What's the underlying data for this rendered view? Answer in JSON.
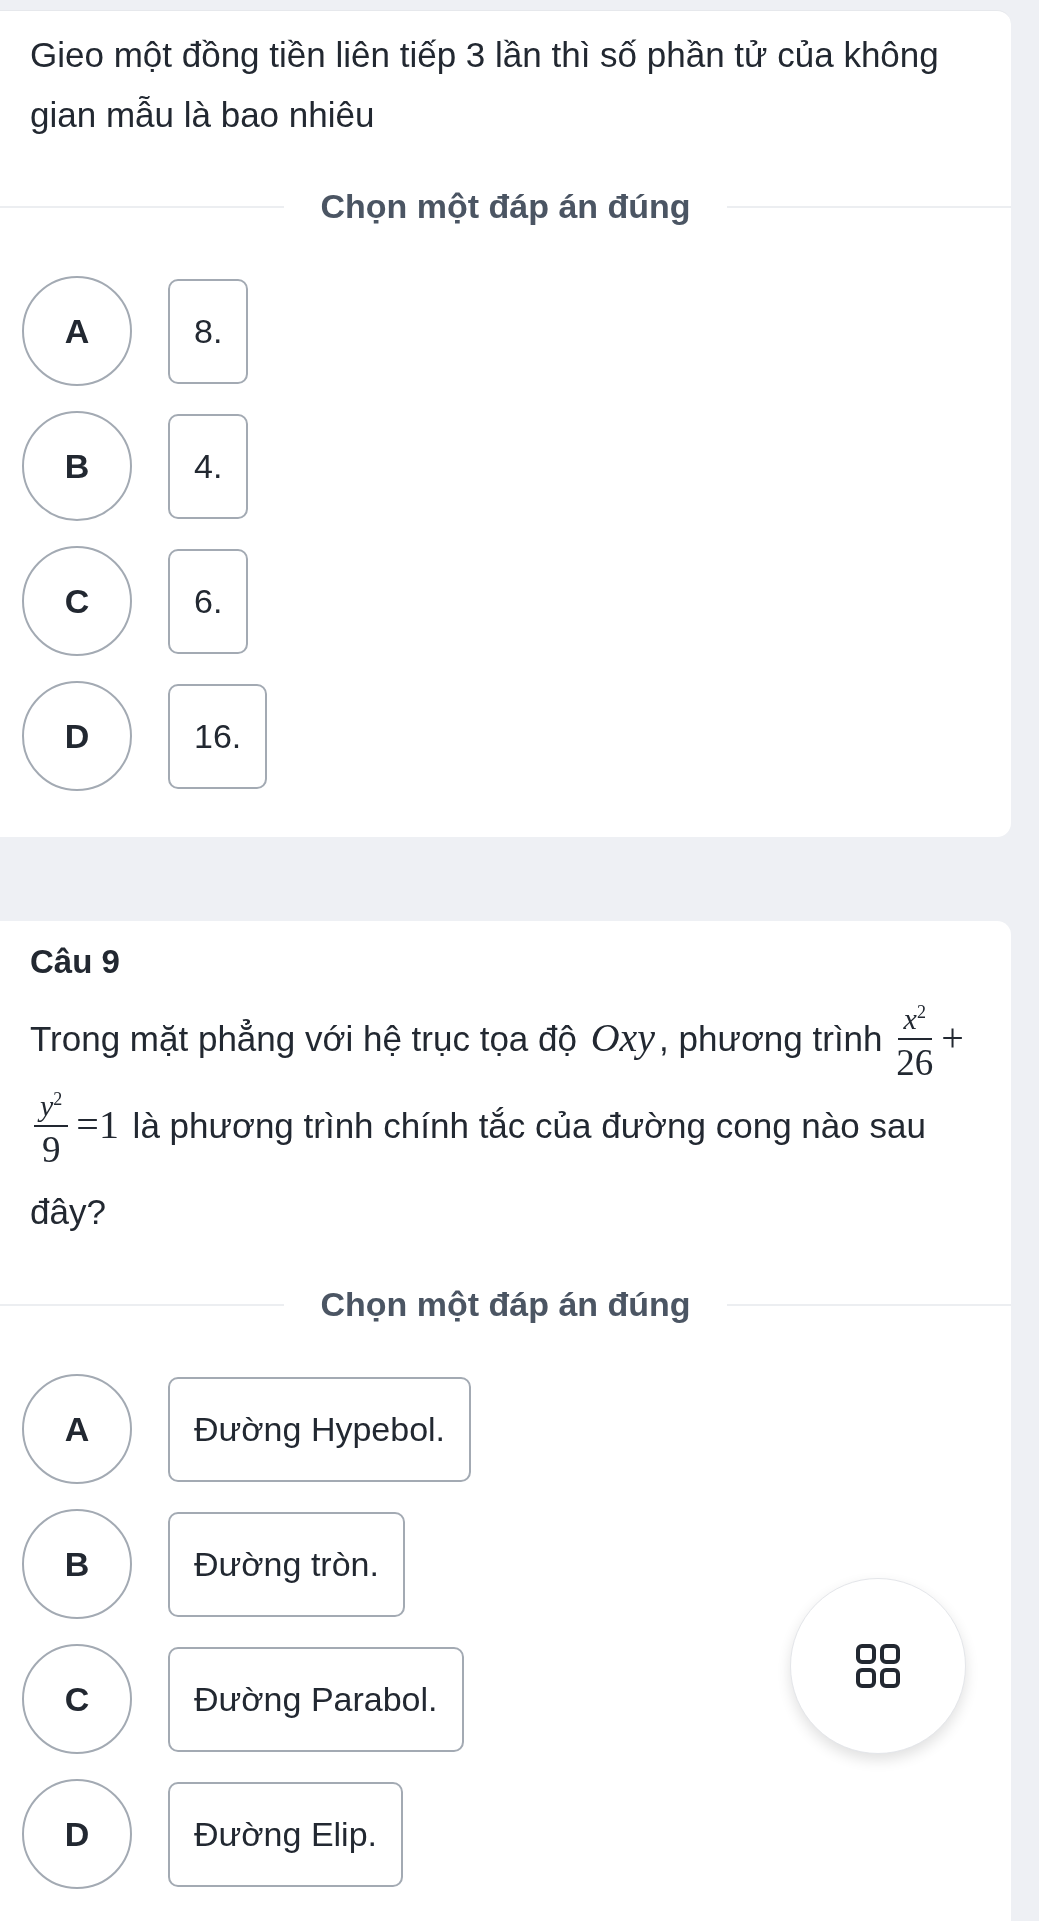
{
  "questions": [
    {
      "segments": [
        {
          "kind": "text",
          "text": "Gieo một đồng tiền liên tiếp 3 lần thì số phần tử của không gian mẫu là bao nhiêu"
        }
      ],
      "prompt": "Chọn một đáp án đúng",
      "options": [
        {
          "letter": "A",
          "text": "8."
        },
        {
          "letter": "B",
          "text": "4."
        },
        {
          "letter": "C",
          "text": "6."
        },
        {
          "letter": "D",
          "text": "16."
        }
      ]
    },
    {
      "title": "Câu 9",
      "segments": [
        {
          "kind": "text",
          "text": "Trong mặt phẳng với hệ trục tọa độ "
        },
        {
          "kind": "var",
          "text": "Oxy"
        },
        {
          "kind": "text",
          "text": ", phương trình "
        },
        {
          "kind": "frac",
          "num": "x$^{2}$",
          "den": "26"
        },
        {
          "kind": "op",
          "text": "+"
        },
        {
          "kind": "frac",
          "num": "y$^{2}$",
          "den": "9"
        },
        {
          "kind": "op",
          "text": "=1"
        },
        {
          "kind": "text",
          "text": " là phương trình chính tắc của đường cong nào sau đây?"
        }
      ],
      "prompt": "Chọn một đáp án đúng",
      "options": [
        {
          "letter": "A",
          "text": "Đường Hypebol."
        },
        {
          "letter": "B",
          "text": "Đường tròn."
        },
        {
          "letter": "C",
          "text": "Đường Parabol."
        },
        {
          "letter": "D",
          "text": "Đường Elip."
        }
      ]
    }
  ],
  "floating_button": {
    "kind": "grid"
  }
}
